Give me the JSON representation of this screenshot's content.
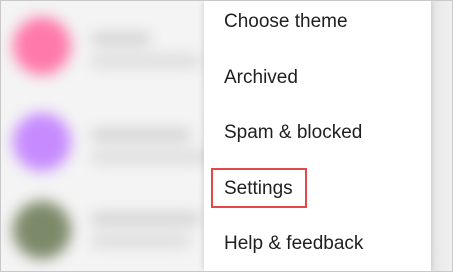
{
  "menu": {
    "items": [
      {
        "label": "Choose theme"
      },
      {
        "label": "Archived"
      },
      {
        "label": "Spam & blocked"
      },
      {
        "label": "Settings",
        "highlighted": true
      },
      {
        "label": "Help & feedback"
      }
    ]
  },
  "colors": {
    "highlight_border": "#e2474b",
    "avatar_1": "#ff7aaa",
    "avatar_2": "#c78bff",
    "avatar_3": "#7d8a6a"
  }
}
